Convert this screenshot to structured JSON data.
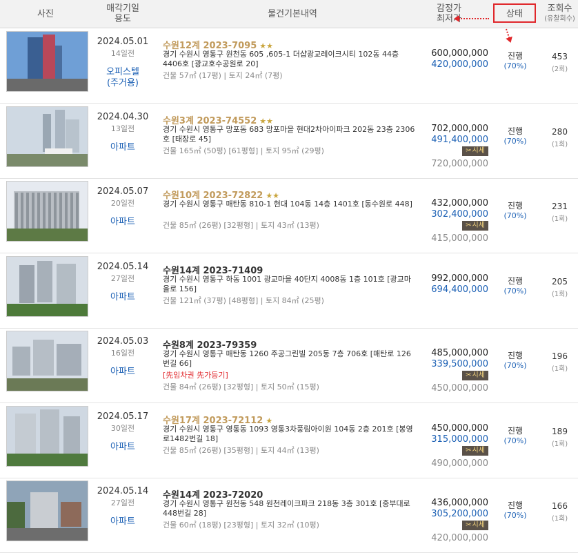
{
  "header": {
    "photo": "사진",
    "date_line1": "매각기일",
    "date_line2": "용도",
    "details": "물건기본내역",
    "price_line1": "감정가",
    "price_line2": "최저가",
    "status": "상태",
    "views_line1": "조회수",
    "views_line2": "(유찰회수)"
  },
  "accent_color": "#e0262a",
  "listings": [
    {
      "date": "2024.05.01",
      "days": "14일전",
      "use": "오피스텔",
      "use2": "(주거용)",
      "case": "수원12계 2023-7095",
      "case_color": "gold",
      "stars": "★★",
      "address": "경기 수원시 영통구 원천동 605 ,605-1 더샵광교레이크시티 102동 44층 4406호 [광교호수공원로 20]",
      "area": "건물 57㎡ (17평)   |   토지 24㎡ (7평)",
      "flags": "",
      "appraisal": "600,000,000",
      "minimum": "420,000,000",
      "market_label": "",
      "market_price": "",
      "status": "진행",
      "ratio": "(70%)",
      "views": "453",
      "fails": "(2회)"
    },
    {
      "date": "2024.04.30",
      "days": "13일전",
      "use": "아파트",
      "use2": "",
      "case": "수원3계 2023-74552",
      "case_color": "gold",
      "stars": "★★",
      "address": "경기 수원시 영통구 망포동 683 망포마을 현대2차아이파크 202동 23층 2306호 [태장로 45]",
      "area": "건물 165㎡ (50평) [61평형]   |   토지 95㎡ (29평)",
      "flags": "",
      "appraisal": "702,000,000",
      "minimum": "491,400,000",
      "market_label": "시세",
      "market_price": "720,000,000",
      "status": "진행",
      "ratio": "(70%)",
      "views": "280",
      "fails": "(1회)"
    },
    {
      "date": "2024.05.07",
      "days": "20일전",
      "use": "아파트",
      "use2": "",
      "case": "수원10계 2023-72822",
      "case_color": "gold",
      "stars": "★★",
      "address": "경기 수원시 영통구 매탄동 810-1 현대 104동 14층 1401호 [동수원로 448]",
      "area": "건물 85㎡ (26평) [32평형]   |   토지 43㎡ (13평)",
      "flags": "",
      "appraisal": "432,000,000",
      "minimum": "302,400,000",
      "market_label": "시세",
      "market_price": "415,000,000",
      "status": "진행",
      "ratio": "(70%)",
      "views": "231",
      "fails": "(1회)"
    },
    {
      "date": "2024.05.14",
      "days": "27일전",
      "use": "아파트",
      "use2": "",
      "case": "수원14계 2023-71409",
      "case_color": "plain",
      "stars": "",
      "address": "경기 수원시 영통구 하동 1001 광교마을 40단지 4008동 1층 101호 [광교마을로 156]",
      "area": "건물 121㎡ (37평) [48평형]   |   토지 84㎡ (25평)",
      "flags": "",
      "appraisal": "992,000,000",
      "minimum": "694,400,000",
      "market_label": "",
      "market_price": "",
      "status": "진행",
      "ratio": "(70%)",
      "views": "205",
      "fails": "(1회)"
    },
    {
      "date": "2024.05.03",
      "days": "16일전",
      "use": "아파트",
      "use2": "",
      "case": "수원8계 2023-79359",
      "case_color": "plain",
      "stars": "",
      "address": "경기 수원시 영통구 매탄동 1260 주공그린빌 205동 7층 706호 [매탄로 126번길 66]",
      "area": "건물 84㎡ (26평) [32평형]   |   토지 50㎡ (15평)",
      "flags": "[先임차권   先가등기]",
      "appraisal": "485,000,000",
      "minimum": "339,500,000",
      "market_label": "시세",
      "market_price": "450,000,000",
      "status": "진행",
      "ratio": "(70%)",
      "views": "196",
      "fails": "(1회)"
    },
    {
      "date": "2024.05.17",
      "days": "30일전",
      "use": "아파트",
      "use2": "",
      "case": "수원17계 2023-72112",
      "case_color": "gold",
      "stars": "★",
      "address": "경기 수원시 영통구 영통동 1093 영통3차풍림아이원 104동 2층 201호 [봉영로1482번길 18]",
      "area": "건물 85㎡ (26평) [35평형]   |   토지 44㎡ (13평)",
      "flags": "",
      "appraisal": "450,000,000",
      "minimum": "315,000,000",
      "market_label": "시세",
      "market_price": "490,000,000",
      "status": "진행",
      "ratio": "(70%)",
      "views": "189",
      "fails": "(1회)"
    },
    {
      "date": "2024.05.14",
      "days": "27일전",
      "use": "아파트",
      "use2": "",
      "case": "수원14계 2023-72020",
      "case_color": "plain",
      "stars": "",
      "address": "경기 수원시 영통구 원천동 548 원천레이크파크 218동 3층 301호 [중부대로448번길 28]",
      "area": "건물 60㎡ (18평) [23평형]   |   토지 32㎡ (10평)",
      "flags": "",
      "appraisal": "436,000,000",
      "minimum": "305,200,000",
      "market_label": "시세",
      "market_price": "420,000,000",
      "status": "진행",
      "ratio": "(70%)",
      "views": "166",
      "fails": "(1회)"
    }
  ]
}
